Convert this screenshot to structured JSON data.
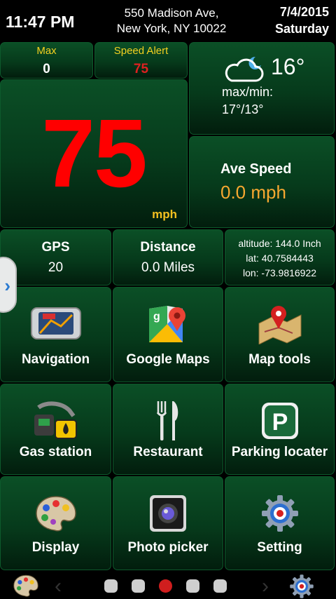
{
  "header": {
    "time": "11:47 PM",
    "address_line1": "550 Madison Ave,",
    "address_line2": "New York, NY 10022",
    "date": "7/4/2015",
    "weekday": "Saturday"
  },
  "max": {
    "label": "Max",
    "value": "0"
  },
  "speed_alert": {
    "label": "Speed Alert",
    "value": "75"
  },
  "speedometer": {
    "value": "75",
    "unit": "mph"
  },
  "weather": {
    "icon": "cloud-night-icon",
    "temp": "16°",
    "label": "max/min:",
    "value": "17°/13°"
  },
  "ave_speed": {
    "label": "Ave Speed",
    "value": "0.0 mph"
  },
  "gps": {
    "label": "GPS",
    "value": "20"
  },
  "distance": {
    "label": "Distance",
    "value": "0.0 Miles"
  },
  "location": {
    "altitude": "altitude: 144.0 Inch",
    "lat": "lat: 40.7584443",
    "lon": "lon: -73.9816922"
  },
  "apps": [
    {
      "label": "Navigation",
      "icon": "gps-device-icon"
    },
    {
      "label": "Google Maps",
      "icon": "google-maps-icon"
    },
    {
      "label": "Map tools",
      "icon": "map-pin-icon"
    },
    {
      "label": "Gas station",
      "icon": "gas-pump-icon"
    },
    {
      "label": "Restaurant",
      "icon": "fork-knife-icon"
    },
    {
      "label": "Parking locater",
      "icon": "parking-icon"
    },
    {
      "label": "Display",
      "icon": "palette-icon"
    },
    {
      "label": "Photo picker",
      "icon": "camera-icon"
    },
    {
      "label": "Setting",
      "icon": "gear-icon"
    }
  ],
  "pager": {
    "pages": 5,
    "active": 3
  },
  "colors": {
    "tile": "#063a1b",
    "speed": "#ff0000",
    "accent": "#f4c020",
    "ave_speed": "#f7a830"
  }
}
